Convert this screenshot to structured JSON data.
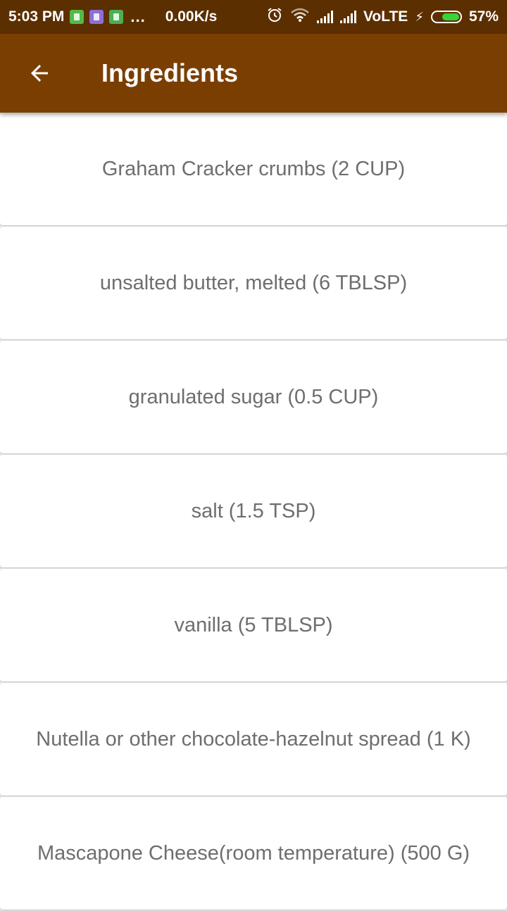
{
  "status_bar": {
    "time": "5:03 PM",
    "more": "...",
    "speed": "0.00K/s",
    "network": "VoLTE",
    "battery": "57%",
    "icons": [
      "sim-notification-icon",
      "app-notification-icon",
      "android-notification-icon",
      "alarm-icon",
      "wifi-icon",
      "signal-icon",
      "signal-icon",
      "charging-icon",
      "battery-icon"
    ]
  },
  "app_bar": {
    "title": "Ingredients",
    "back_icon": "arrow-back-icon",
    "background": "#7a3f00"
  },
  "ingredients": [
    {
      "label": "Graham Cracker crumbs (2 CUP)"
    },
    {
      "label": "unsalted butter, melted (6 TBLSP)"
    },
    {
      "label": "granulated sugar (0.5 CUP)"
    },
    {
      "label": "salt (1.5 TSP)"
    },
    {
      "label": "vanilla (5 TBLSP)"
    },
    {
      "label": "Nutella or other chocolate-hazelnut spread (1 K)"
    },
    {
      "label": "Mascapone Cheese(room temperature) (500 G)"
    }
  ]
}
